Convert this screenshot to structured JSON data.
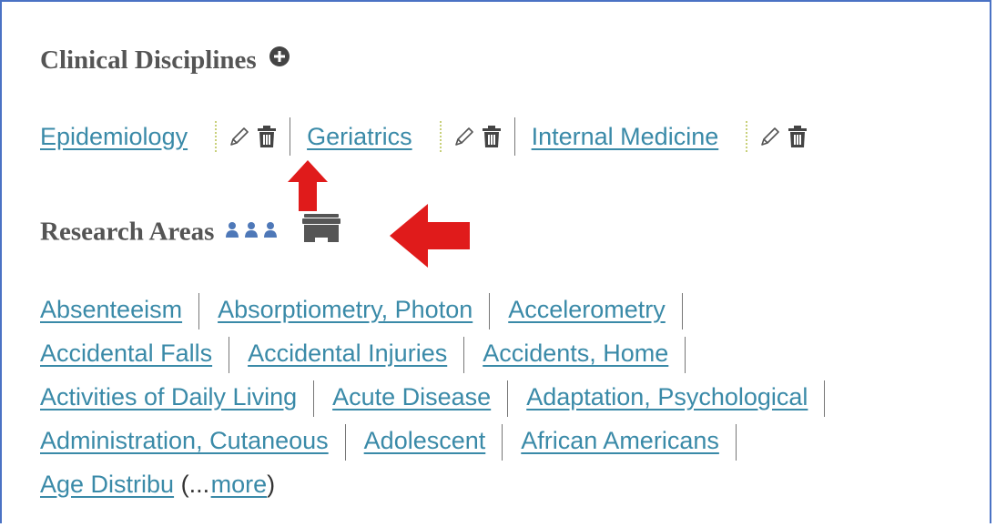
{
  "clinical_disciplines": {
    "title": "Clinical Disciplines",
    "add_icon": "plus-circle-icon",
    "items": [
      {
        "label": "Epidemiology"
      },
      {
        "label": "Geriatrics"
      },
      {
        "label": "Internal Medicine"
      }
    ]
  },
  "research_areas": {
    "title": "Research Areas",
    "items": [
      "Absenteeism",
      "Absorptiometry, Photon",
      "Accelerometry",
      "Accidental Falls",
      "Accidental Injuries",
      "Accidents, Home",
      "Activities of Daily Living",
      "Acute Disease",
      "Adaptation, Psychological",
      "Administration, Cutaneous",
      "Adolescent",
      "African Americans"
    ],
    "truncated": "Age Distribu",
    "more_open": "(...",
    "more_label": "more",
    "more_close": ")"
  },
  "colors": {
    "link": "#3a8aa8",
    "heading": "#555555",
    "annotation_arrow": "#e01b1b",
    "frame": "#4a72c4"
  }
}
